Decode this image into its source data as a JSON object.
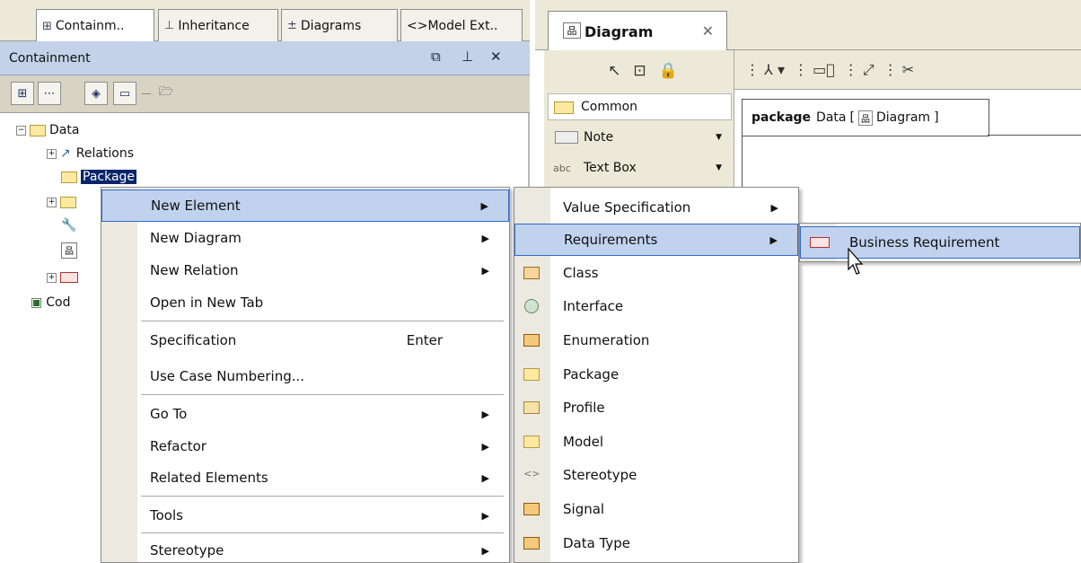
{
  "left_tabs": [
    {
      "label": "Containm..",
      "icon": "containment-tree-icon",
      "active": true
    },
    {
      "label": "Inheritance",
      "icon": "inheritance-icon",
      "active": false
    },
    {
      "label": "Diagrams",
      "icon": "diagrams-icon",
      "active": false
    },
    {
      "label": "<>Model Ext..",
      "icon": "model-extension-icon",
      "active": false
    }
  ],
  "containment": {
    "title": "Containment",
    "header_controls": [
      "restore-icon",
      "pin-icon",
      "close-icon"
    ]
  },
  "tree": {
    "root_label": "Data",
    "relations_label": "Relations",
    "package_label": "Package",
    "code_label": "Cod"
  },
  "diagram_tab": {
    "label": "Diagram",
    "close": "✕"
  },
  "palette": {
    "group_label": "Common",
    "items": [
      {
        "label": "Note",
        "icon": "note-icon"
      },
      {
        "label": "Text Box",
        "icon": "text-box-icon",
        "prefix": "abc"
      }
    ]
  },
  "canvas": {
    "keyword": "package",
    "name": "Data",
    "bracket_open": "[",
    "diagram_label": "Diagram",
    "bracket_close": "]"
  },
  "context_menu": {
    "items": [
      {
        "label": "New Element",
        "submenu": true,
        "highlight": true
      },
      {
        "label": "New Diagram",
        "submenu": true
      },
      {
        "label": "New Relation",
        "submenu": true
      },
      {
        "label": "Open in New Tab"
      },
      {
        "label": "Specification",
        "shortcut": "Enter"
      },
      {
        "label": "Use Case Numbering..."
      },
      {
        "label": "Go To",
        "submenu": true
      },
      {
        "label": "Refactor",
        "submenu": true
      },
      {
        "label": "Related Elements",
        "submenu": true
      },
      {
        "label": "Tools",
        "submenu": true
      },
      {
        "label": "Stereotype",
        "submenu": true
      }
    ]
  },
  "new_element_menu": {
    "items": [
      {
        "label": "Value Specification",
        "submenu": true,
        "icon": ""
      },
      {
        "label": "Requirements",
        "submenu": true,
        "highlight": true,
        "icon": ""
      },
      {
        "label": "Class",
        "icon": "class-icon"
      },
      {
        "label": "Interface",
        "icon": "interface-icon"
      },
      {
        "label": "Enumeration",
        "icon": "enumeration-icon"
      },
      {
        "label": "Package",
        "icon": "package-icon"
      },
      {
        "label": "Profile",
        "icon": "profile-icon"
      },
      {
        "label": "Model",
        "icon": "model-icon"
      },
      {
        "label": "Stereotype",
        "icon": "stereotype-icon"
      },
      {
        "label": "Signal",
        "icon": "signal-icon"
      },
      {
        "label": "Data Type",
        "icon": "data-type-icon"
      }
    ]
  },
  "requirements_menu": {
    "items": [
      {
        "label": "Business Requirement",
        "icon": "requirement-icon",
        "highlight": true
      }
    ]
  },
  "colors": {
    "menu_highlight": "#c1d2ee",
    "menu_highlight_border": "#316ac5",
    "panel_header": "#c3d1e9",
    "chrome": "#ece9d8"
  }
}
